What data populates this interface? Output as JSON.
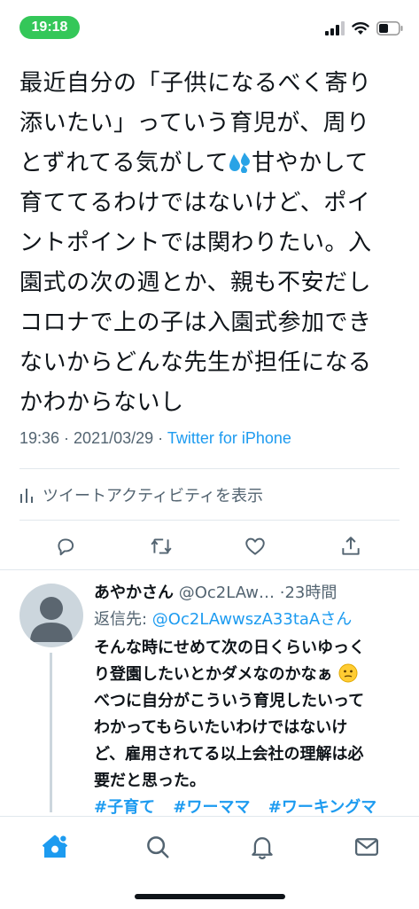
{
  "status_bar": {
    "time": "19:18"
  },
  "tweet": {
    "text_part1": "最近自分の「子供になるべく寄り\n添いたい」っていう育児が、周り\nとずれてる気がして",
    "emoji_name": "sweat-droplets",
    "text_part2": "甘やかして\n育ててるわけではないけど、ポイ\nントポイントでは関わりたい。入\n園式の次の週とか、親も不安だし\nコロナで上の子は入園式参加でき\nないからどんな先生が担任になる\nかわからないし",
    "time": "19:36",
    "sep": " · ",
    "date": "2021/03/29",
    "source": "Twitter for iPhone",
    "activity_label": "ツイートアクティビティを表示"
  },
  "reply": {
    "name": "あやかさん",
    "handle": "@Oc2LAw…",
    "ago": "·23時間",
    "reply_to_label": "返信先: ",
    "reply_to_handle": "@Oc2LAwwszA33taAさん",
    "text_part1": "そんな時にせめて次の日くらいゆっく\nり登園したいとかダメなのかなぁ",
    "text_part2": "\nべつに自分がこういう育児したいって\nわかってもらいたいわけではないけ\nど、雇用されてる以上会社の理解は必\n要だと思った。",
    "hashtags": [
      "#子育て",
      "#ワーママ",
      "#ワーキングマ"
    ]
  },
  "icons": {
    "actions": [
      "reply-icon",
      "retweet-icon",
      "like-icon",
      "share-icon"
    ],
    "tabs": [
      "home-icon",
      "search-icon",
      "notifications-icon",
      "messages-icon"
    ]
  },
  "colors": {
    "accent": "#1d9bf0",
    "time_pill": "#34c759",
    "muted": "#536471"
  }
}
